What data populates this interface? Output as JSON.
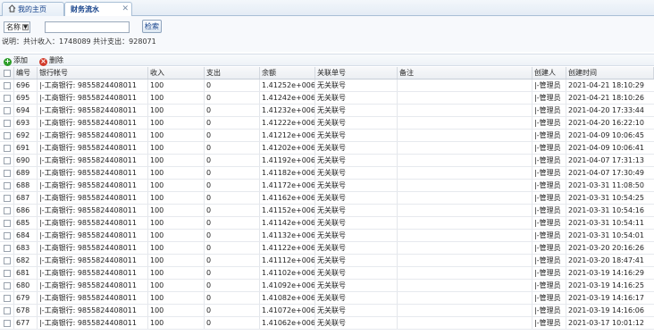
{
  "tabs": [
    {
      "label": "我的主页",
      "active": false
    },
    {
      "label": "财务流水",
      "active": true
    }
  ],
  "search": {
    "field_select": "名称",
    "input_value": "",
    "button_label": "检索"
  },
  "summary": {
    "text": "说明：共计收入：1748089  共计支出：928071"
  },
  "actions": {
    "add_label": "添加",
    "delete_label": "删除"
  },
  "table": {
    "columns": [
      "编号",
      "银行帐号",
      "收入",
      "支出",
      "余额",
      "关联单号",
      "备注",
      "创建人",
      "创建时间"
    ],
    "rows": [
      {
        "id": "696",
        "bank": "|-工商银行: 9855824408011",
        "income": "100",
        "expense": "0",
        "balance": "1.41252e+006",
        "related": "无关联号",
        "note": "",
        "creator": "|-管理员",
        "time": "2021-04-21 18:10:29"
      },
      {
        "id": "695",
        "bank": "|-工商银行: 9855824408011",
        "income": "100",
        "expense": "0",
        "balance": "1.41242e+006",
        "related": "无关联号",
        "note": "",
        "creator": "|-管理员",
        "time": "2021-04-21 18:10:26"
      },
      {
        "id": "694",
        "bank": "|-工商银行: 9855824408011",
        "income": "100",
        "expense": "0",
        "balance": "1.41232e+006",
        "related": "无关联号",
        "note": "",
        "creator": "|-管理员",
        "time": "2021-04-20 17:33:44"
      },
      {
        "id": "693",
        "bank": "|-工商银行: 9855824408011",
        "income": "100",
        "expense": "0",
        "balance": "1.41222e+006",
        "related": "无关联号",
        "note": "",
        "creator": "|-管理员",
        "time": "2021-04-20 16:22:10"
      },
      {
        "id": "692",
        "bank": "|-工商银行: 9855824408011",
        "income": "100",
        "expense": "0",
        "balance": "1.41212e+006",
        "related": "无关联号",
        "note": "",
        "creator": "|-管理员",
        "time": "2021-04-09 10:06:45"
      },
      {
        "id": "691",
        "bank": "|-工商银行: 9855824408011",
        "income": "100",
        "expense": "0",
        "balance": "1.41202e+006",
        "related": "无关联号",
        "note": "",
        "creator": "|-管理员",
        "time": "2021-04-09 10:06:41"
      },
      {
        "id": "690",
        "bank": "|-工商银行: 9855824408011",
        "income": "100",
        "expense": "0",
        "balance": "1.41192e+006",
        "related": "无关联号",
        "note": "",
        "creator": "|-管理员",
        "time": "2021-04-07 17:31:13"
      },
      {
        "id": "689",
        "bank": "|-工商银行: 9855824408011",
        "income": "100",
        "expense": "0",
        "balance": "1.41182e+006",
        "related": "无关联号",
        "note": "",
        "creator": "|-管理员",
        "time": "2021-04-07 17:30:49"
      },
      {
        "id": "688",
        "bank": "|-工商银行: 9855824408011",
        "income": "100",
        "expense": "0",
        "balance": "1.41172e+006",
        "related": "无关联号",
        "note": "",
        "creator": "|-管理员",
        "time": "2021-03-31 11:08:50"
      },
      {
        "id": "687",
        "bank": "|-工商银行: 9855824408011",
        "income": "100",
        "expense": "0",
        "balance": "1.41162e+006",
        "related": "无关联号",
        "note": "",
        "creator": "|-管理员",
        "time": "2021-03-31 10:54:25"
      },
      {
        "id": "686",
        "bank": "|-工商银行: 9855824408011",
        "income": "100",
        "expense": "0",
        "balance": "1.41152e+006",
        "related": "无关联号",
        "note": "",
        "creator": "|-管理员",
        "time": "2021-03-31 10:54:16"
      },
      {
        "id": "685",
        "bank": "|-工商银行: 9855824408011",
        "income": "100",
        "expense": "0",
        "balance": "1.41142e+006",
        "related": "无关联号",
        "note": "",
        "creator": "|-管理员",
        "time": "2021-03-31 10:54:11"
      },
      {
        "id": "684",
        "bank": "|-工商银行: 9855824408011",
        "income": "100",
        "expense": "0",
        "balance": "1.41132e+006",
        "related": "无关联号",
        "note": "",
        "creator": "|-管理员",
        "time": "2021-03-31 10:54:01"
      },
      {
        "id": "683",
        "bank": "|-工商银行: 9855824408011",
        "income": "100",
        "expense": "0",
        "balance": "1.41122e+006",
        "related": "无关联号",
        "note": "",
        "creator": "|-管理员",
        "time": "2021-03-20 20:16:26"
      },
      {
        "id": "682",
        "bank": "|-工商银行: 9855824408011",
        "income": "100",
        "expense": "0",
        "balance": "1.41112e+006",
        "related": "无关联号",
        "note": "",
        "creator": "|-管理员",
        "time": "2021-03-20 18:47:41"
      },
      {
        "id": "681",
        "bank": "|-工商银行: 9855824408011",
        "income": "100",
        "expense": "0",
        "balance": "1.41102e+006",
        "related": "无关联号",
        "note": "",
        "creator": "|-管理员",
        "time": "2021-03-19 14:16:29"
      },
      {
        "id": "680",
        "bank": "|-工商银行: 9855824408011",
        "income": "100",
        "expense": "0",
        "balance": "1.41092e+006",
        "related": "无关联号",
        "note": "",
        "creator": "|-管理员",
        "time": "2021-03-19 14:16:25"
      },
      {
        "id": "679",
        "bank": "|-工商银行: 9855824408011",
        "income": "100",
        "expense": "0",
        "balance": "1.41082e+006",
        "related": "无关联号",
        "note": "",
        "creator": "|-管理员",
        "time": "2021-03-19 14:16:17"
      },
      {
        "id": "678",
        "bank": "|-工商银行: 9855824408011",
        "income": "100",
        "expense": "0",
        "balance": "1.41072e+006",
        "related": "无关联号",
        "note": "",
        "creator": "|-管理员",
        "time": "2021-03-19 14:16:06"
      },
      {
        "id": "677",
        "bank": "|-工商银行: 9855824408011",
        "income": "100",
        "expense": "0",
        "balance": "1.41062e+006",
        "related": "无关联号",
        "note": "",
        "creator": "|-管理员",
        "time": "2021-03-17 10:01:12"
      }
    ]
  }
}
